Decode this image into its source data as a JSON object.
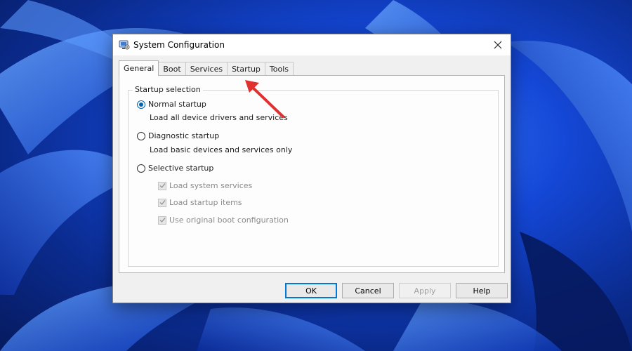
{
  "window": {
    "title": "System Configuration",
    "close_icon": "close-icon",
    "app_icon": "system-configuration-icon"
  },
  "tabs": [
    {
      "label": "General",
      "active": true
    },
    {
      "label": "Boot",
      "active": false
    },
    {
      "label": "Services",
      "active": false
    },
    {
      "label": "Startup",
      "active": false
    },
    {
      "label": "Tools",
      "active": false
    }
  ],
  "startup_selection": {
    "legend": "Startup selection",
    "normal": {
      "label": "Normal startup",
      "description": "Load all device drivers and services",
      "checked": true
    },
    "diagnostic": {
      "label": "Diagnostic startup",
      "description": "Load basic devices and services only",
      "checked": false
    },
    "selective": {
      "label": "Selective startup",
      "checked": false
    },
    "options": [
      {
        "label": "Load system services",
        "checked": true,
        "disabled": true
      },
      {
        "label": "Load startup items",
        "checked": true,
        "disabled": true
      },
      {
        "label": "Use original boot configuration",
        "checked": true,
        "disabled": true
      }
    ]
  },
  "buttons": {
    "ok": "OK",
    "cancel": "Cancel",
    "apply": "Apply",
    "help": "Help"
  },
  "colors": {
    "accent": "#0078d7",
    "annotation_arrow": "#e03030"
  }
}
